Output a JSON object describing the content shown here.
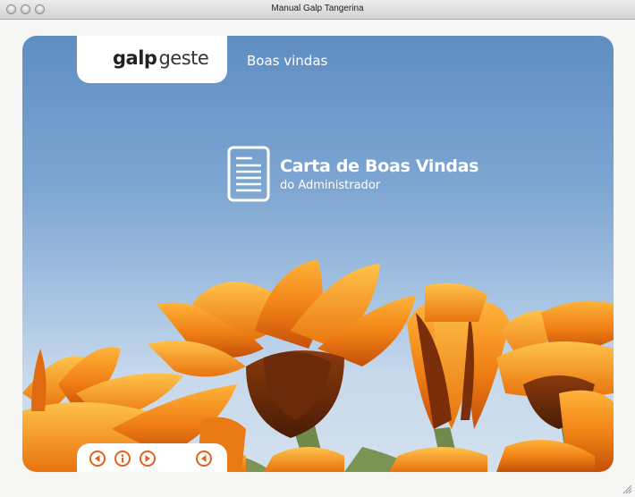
{
  "window": {
    "title": "Manual Galp Tangerina"
  },
  "header": {
    "logo_text_bold": "galp",
    "logo_text_light": "geste",
    "section_title": "Boas vindas"
  },
  "content": {
    "letter_title": "Carta de Boas Vindas",
    "letter_subtitle": "do Administrador",
    "icon": "document-icon"
  },
  "navigation": {
    "buttons": [
      {
        "name": "previous",
        "icon": "arrow-left-icon"
      },
      {
        "name": "info",
        "icon": "info-icon"
      },
      {
        "name": "next",
        "icon": "arrow-right-icon"
      },
      {
        "name": "sound",
        "icon": "speaker-icon"
      }
    ]
  },
  "colors": {
    "accent": "#e1621a",
    "sky_top": "#5f8ec2",
    "sky_bottom": "#d3e0ee",
    "flower_orange": "#f08a1c"
  }
}
